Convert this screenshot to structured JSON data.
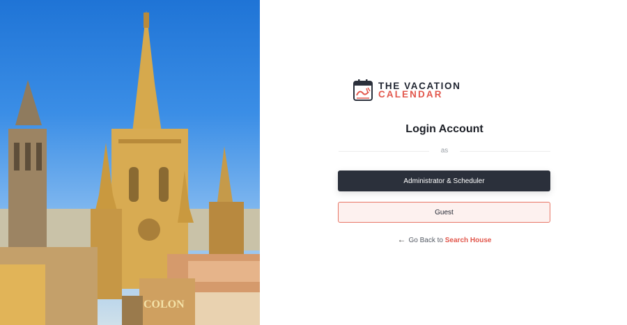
{
  "hero": {
    "sign_text": "COLON"
  },
  "brand": {
    "line1": "THE VACATION",
    "line2": "CALENDAR",
    "icon": "calendar-wave-logo-icon",
    "accent_color": "#e2574c"
  },
  "login": {
    "title": "Login Account",
    "divider_text": "as",
    "admin_button": "Administrator & Scheduler",
    "guest_button": "Guest"
  },
  "back": {
    "arrow": "←",
    "prefix": "Go Back to",
    "link": "Search House"
  }
}
